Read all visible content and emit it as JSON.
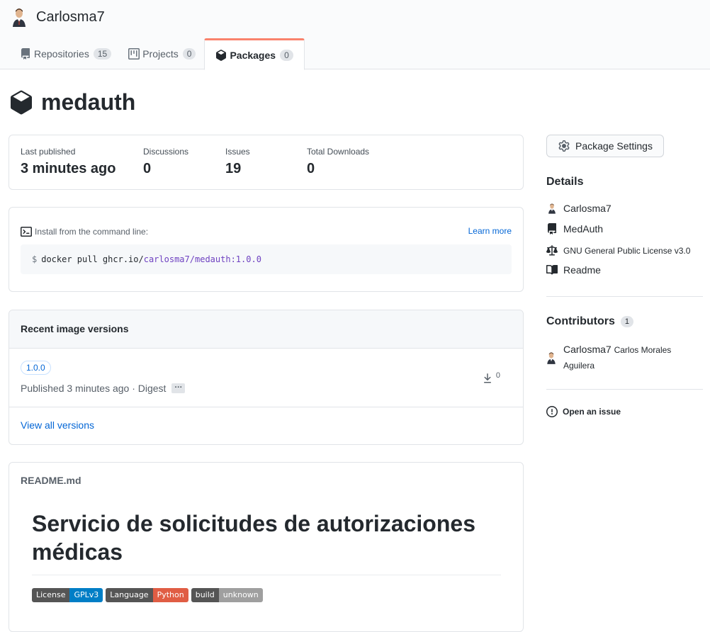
{
  "header": {
    "username": "Carlosma7",
    "tabs": [
      {
        "label": "Repositories",
        "count": "15",
        "icon": "repo-icon"
      },
      {
        "label": "Projects",
        "count": "0",
        "icon": "project-icon"
      },
      {
        "label": "Packages",
        "count": "0",
        "icon": "package-icon",
        "selected": true
      }
    ]
  },
  "package": {
    "name": "medauth"
  },
  "stats": [
    {
      "label": "Last published",
      "value": "3 minutes ago"
    },
    {
      "label": "Discussions",
      "value": "0"
    },
    {
      "label": "Issues",
      "value": "19"
    },
    {
      "label": "Total Downloads",
      "value": "0"
    }
  ],
  "install": {
    "label": "Install from the command line:",
    "learn_more": "Learn more",
    "prompt": "$",
    "cmd_prefix": "docker pull ghcr.io/",
    "cmd_user": "carlosma7",
    "cmd_slash": "/",
    "cmd_image": "medauth:1.0.0"
  },
  "versions": {
    "title": "Recent image versions",
    "items": [
      {
        "tag": "1.0.0",
        "meta": "Published 3 minutes ago · Digest",
        "downloads": "0"
      }
    ],
    "view_all": "View all versions"
  },
  "readme": {
    "filename": "README.md",
    "heading": "Servicio de solicitudes de autorizaciones médicas",
    "badges": [
      {
        "left": "License",
        "right": "GPLv3",
        "color": "#007ec6"
      },
      {
        "left": "Language",
        "right": "Python",
        "color": "#e05d44"
      },
      {
        "left": "build",
        "right": "unknown",
        "color": "#9f9f9f"
      }
    ]
  },
  "sidebar": {
    "settings_button": "Package Settings",
    "details_title": "Details",
    "details": {
      "owner": "Carlosma7",
      "repo": "MedAuth",
      "license": "GNU General Public License v3.0",
      "readme": "Readme"
    },
    "contributors_title": "Contributors",
    "contributors_count": "1",
    "contributor": {
      "login": "Carlosma7",
      "full_name_1": "Carlos Morales",
      "full_name_2": "Aguilera"
    },
    "open_issue": "Open an issue"
  },
  "colors": {
    "accent_tab": "#f9826c",
    "link": "#0366d6"
  }
}
